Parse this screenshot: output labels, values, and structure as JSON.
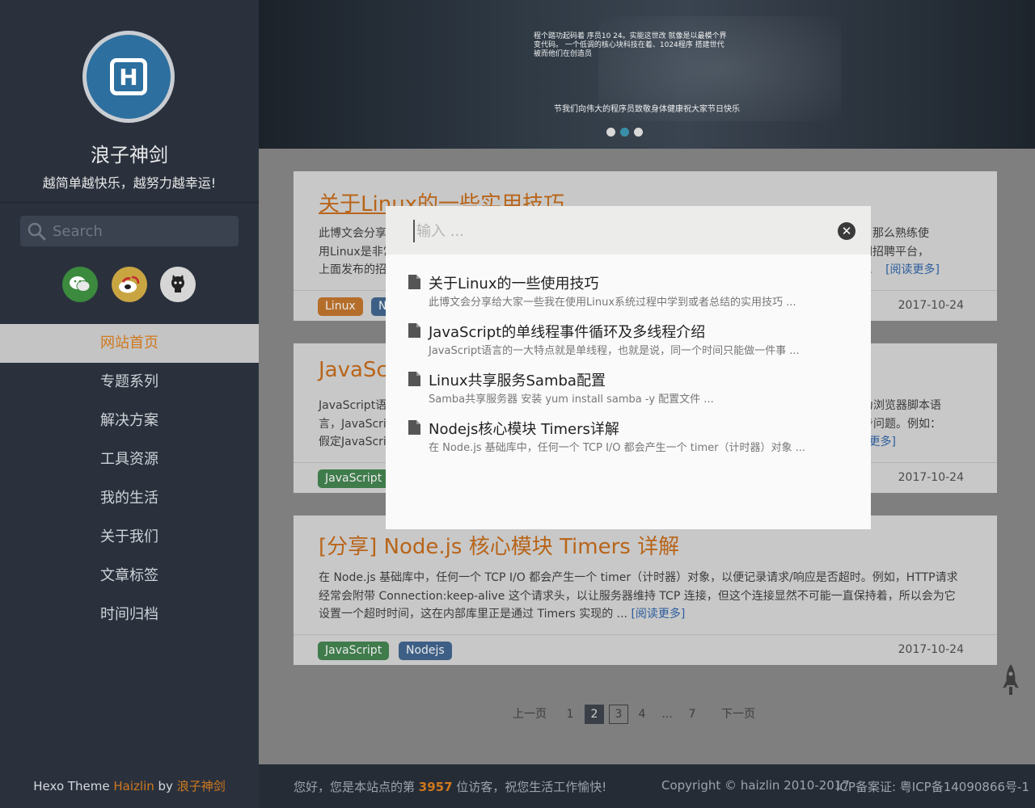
{
  "sidebar": {
    "site_name": "浪子神剑",
    "site_desc": "越简单越快乐，越努力越幸运!",
    "search_placeholder": "Search",
    "social": [
      "wechat-icon",
      "weibo-icon",
      "github-icon"
    ],
    "nav": [
      {
        "label": "网站首页",
        "active": true
      },
      {
        "label": "专题系列",
        "active": false
      },
      {
        "label": "解决方案",
        "active": false
      },
      {
        "label": "工具资源",
        "active": false
      },
      {
        "label": "我的生活",
        "active": false
      },
      {
        "label": "关于我们",
        "active": false
      },
      {
        "label": "文章标签",
        "active": false
      },
      {
        "label": "时间归档",
        "active": false
      }
    ],
    "footer": {
      "prefix": "Hexo Theme ",
      "theme": "Haizlin",
      "by": " by ",
      "author": "浪子神剑"
    }
  },
  "banner": {
    "poem": "程个踏功起码着 序员10 24。实能这世改 就像是以最模个界变代码。 一个低调的核心块科技在着、1024程序 搭建世代 被而他们在创造员",
    "caption": "节我们向伟大的程序员致敬身体健康祝大家节日快乐",
    "slides": 3,
    "active_slide": 2
  },
  "posts": [
    {
      "title": "关于Linux的一些实用技巧",
      "excerpt_left": "此博文会分享",
      "excerpt_right": "业，那么熟练使",
      "line2_left": "用Linux是非常",
      "line2_right": "联网招聘平台，",
      "line3_left": "上面发布的招",
      "line3_right": "！...",
      "more": "[阅读更多]",
      "tags": [
        {
          "label": "Linux",
          "color": "orange"
        },
        {
          "label": "N",
          "color": "blue"
        }
      ],
      "date": "2017-10-24"
    },
    {
      "title": "JavaScr",
      "excerpt_left": "JavaScript语言",
      "excerpt_right": "作为浏览器脚本语",
      "line2_left": "言，JavaScri",
      "line2_right": "同步问题。例如：",
      "line3_left": "假定JavaScri",
      "line3_right": "",
      "more": "读更多]",
      "tags": [
        {
          "label": "JavaScript",
          "color": "green"
        }
      ],
      "date": "2017-10-24"
    },
    {
      "title": "[分享] Node.js 核心模块 Timers 详解",
      "excerpt": "在 Node.js 基础库中，任何一个 TCP I/O 都会产生一个 timer（计时器）对象，以便记录请求/响应是否超时。例如，HTTP请求经常会附带 Connection:keep-alive 这个请求头，以让服务器维持 TCP 连接，但这个连接显然不可能一直保持着，所以会为它设置一个超时时间，这在内部库里正是通过 Timers 实现的 ...",
      "more": "[阅读更多]",
      "tags": [
        {
          "label": "JavaScript",
          "color": "green"
        },
        {
          "label": "Nodejs",
          "color": "blue"
        }
      ],
      "date": "2017-10-24"
    }
  ],
  "pager": {
    "prev": "上一页",
    "pages": [
      "1",
      "2",
      "3",
      "4",
      "...",
      "7"
    ],
    "current": "2",
    "next": "下一页"
  },
  "footer": {
    "visit_prefix": "您好，您是本站点的第 ",
    "visit_count": "3957",
    "visit_suffix": " 位访客，祝您生活工作愉快!",
    "copyright": "Copyright © haizlin 2010-2017",
    "icp": "ICP备案证: 粤ICP备14090866号-1"
  },
  "search_modal": {
    "placeholder": "输入 ...",
    "results": [
      {
        "title": "关于Linux的一些使用技巧",
        "desc": "此博文会分享给大家一些我在使用Linux系统过程中学到或者总结的实用技巧 ..."
      },
      {
        "title": "JavaScript的单线程事件循环及多线程介绍",
        "desc": "JavaScript语言的一大特点就是单线程，也就是说，同一个时间只能做一件事 ..."
      },
      {
        "title": "Linux共享服务Samba配置",
        "desc": "Samba共享服务器 安装 yum install samba -y 配置文件 ..."
      },
      {
        "title": "Nodejs核心模块 Timers详解",
        "desc": "在 Node.js 基础库中，任何一个 TCP I/O 都会产生一个 timer（计时器）对象 ..."
      }
    ]
  }
}
